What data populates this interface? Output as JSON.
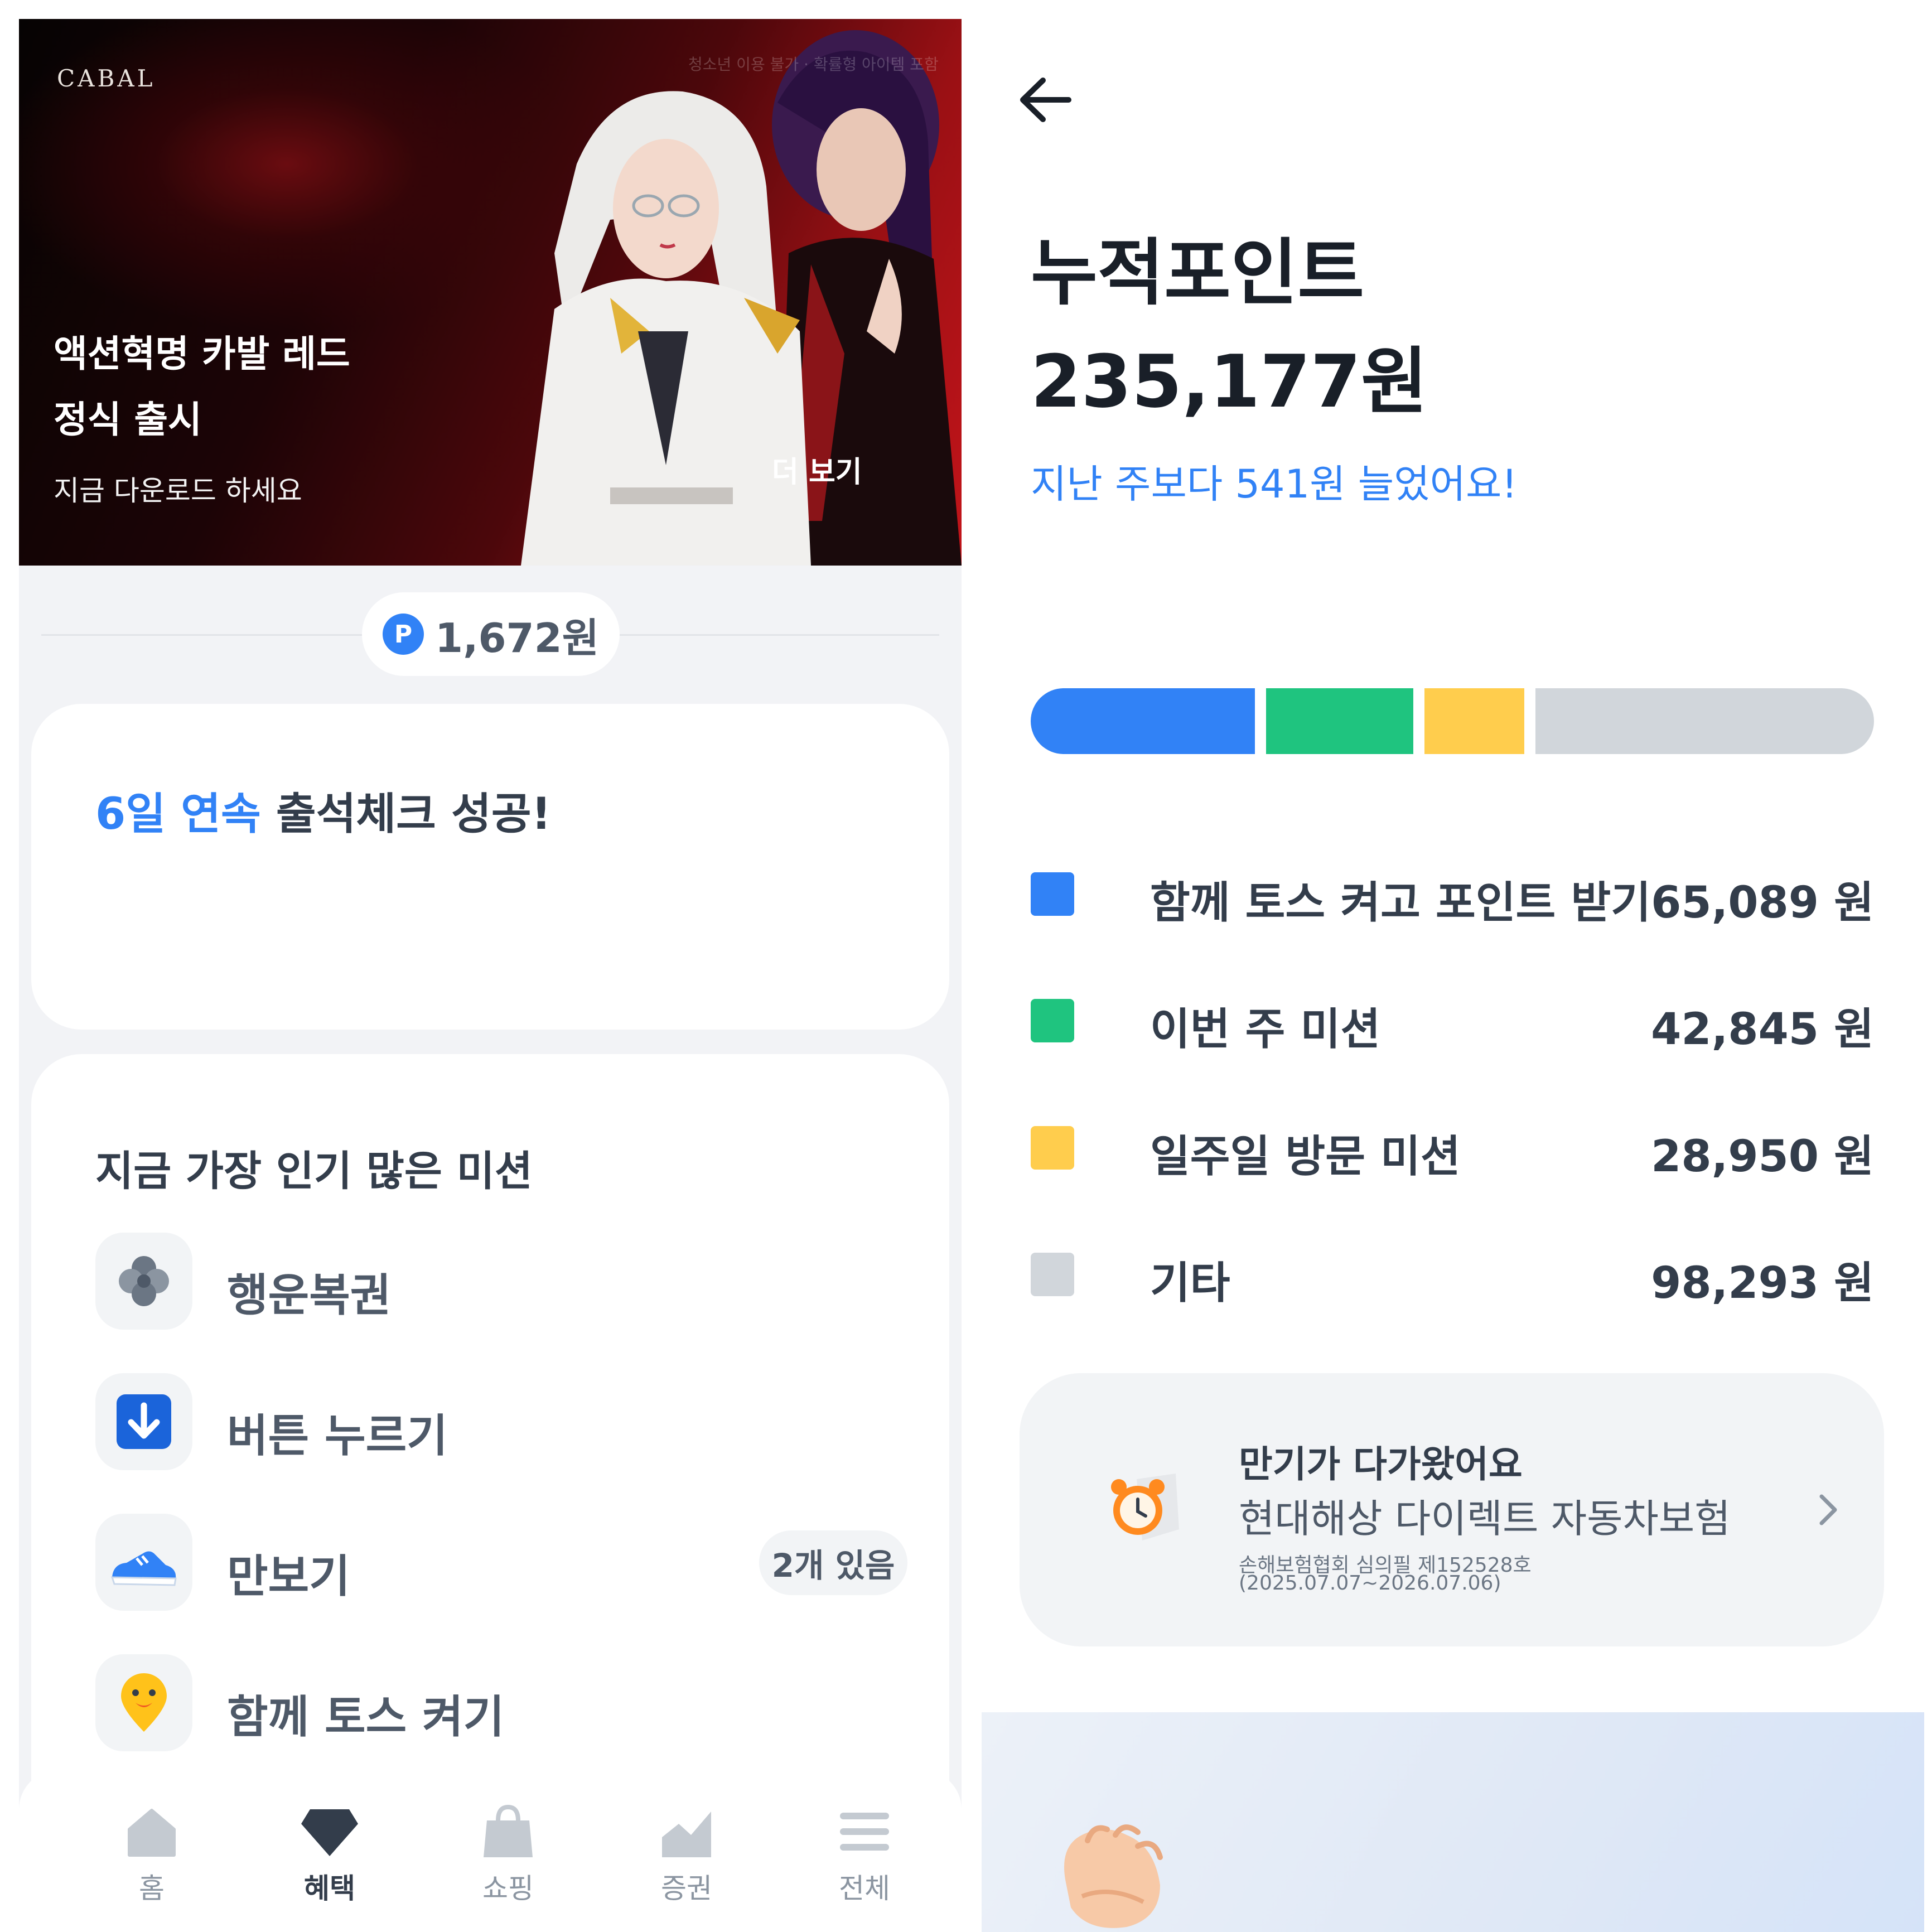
{
  "left": {
    "banner": {
      "logo": "CABAL",
      "rating_note": "청소년 이용 불가 · 확률형 아이템 포함",
      "title_line1": "액션혁명 카발 레드",
      "title_line2": "정식 출시",
      "subtitle": "지금 다운로드 하세요",
      "more": "더 보기"
    },
    "points": {
      "icon": "P",
      "value": "1,672원"
    },
    "attendance": {
      "highlight": "6일 연속",
      "rest": " 출석체크 성공!"
    },
    "missions": {
      "title": "지금 가장 인기 많은 미션",
      "items": [
        {
          "icon": "clover-icon",
          "label": "행운복권"
        },
        {
          "icon": "download-arrow-icon",
          "label": "버튼 누르기"
        },
        {
          "icon": "sneaker-icon",
          "label": "만보기",
          "badge": "2개 있음"
        },
        {
          "icon": "smiley-pin-icon",
          "label": "함께 토스 켜기"
        }
      ]
    },
    "tabs": [
      {
        "icon": "home-icon",
        "label": "홈"
      },
      {
        "icon": "gem-icon",
        "label": "혜택",
        "active": true
      },
      {
        "icon": "shopping-bag-icon",
        "label": "쇼핑"
      },
      {
        "icon": "stock-chart-icon",
        "label": "증권"
      },
      {
        "icon": "menu-icon",
        "label": "전체"
      }
    ]
  },
  "right": {
    "title": "누적포인트",
    "total": "235,177원",
    "change": "지난 주보다 541원 늘었어요!",
    "breakdown": [
      {
        "label": "함께 토스 켜고 포인트 받기",
        "value": "65,089 원",
        "amount": 65089,
        "color": "#3182f6"
      },
      {
        "label": "이번 주 미션",
        "value": "42,845 원",
        "amount": 42845,
        "color": "#1fc47f"
      },
      {
        "label": "일주일 방문 미션",
        "value": "28,950 원",
        "amount": 28950,
        "color": "#ffcd4d"
      },
      {
        "label": "기타",
        "value": "98,293 원",
        "amount": 98293,
        "color": "#d1d6db"
      }
    ],
    "insurance": {
      "title": "만기가 다가왔어요",
      "name": "현대해상 다이렉트 자동차보험",
      "note1": "손해보험협회 심의필 제152528호",
      "note2": "(2025.07.07~2026.07.06)"
    }
  }
}
